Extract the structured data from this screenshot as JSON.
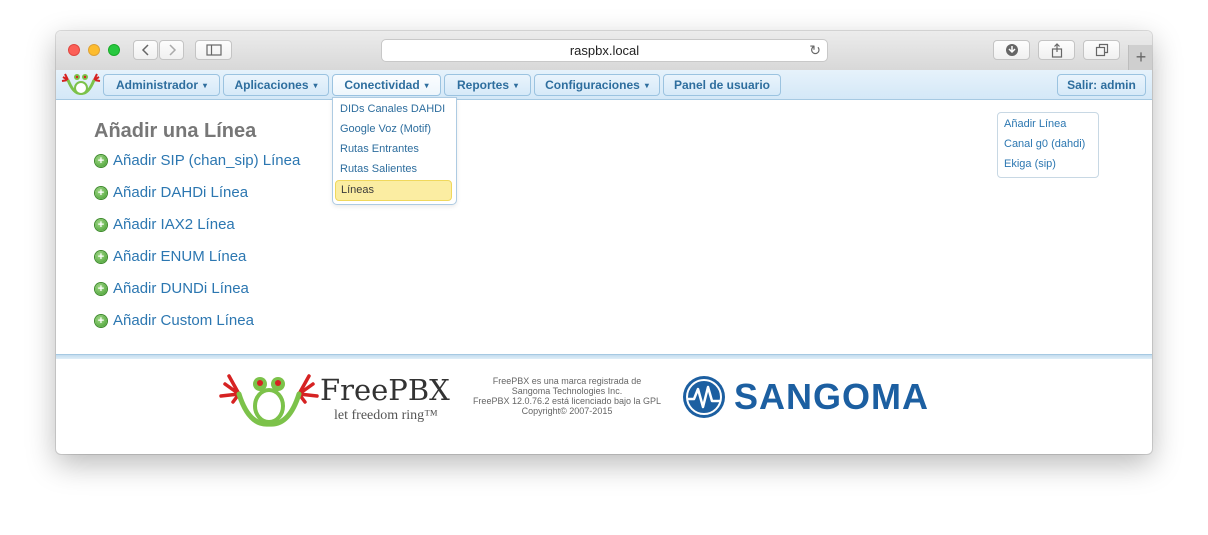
{
  "browser": {
    "url": "raspbx.local"
  },
  "menu": {
    "items": [
      {
        "label": "Administrador",
        "has_caret": true
      },
      {
        "label": "Aplicaciones",
        "has_caret": true
      },
      {
        "label": "Conectividad",
        "has_caret": true
      },
      {
        "label": "Reportes",
        "has_caret": true
      },
      {
        "label": "Configuraciones",
        "has_caret": true
      },
      {
        "label": "Panel de usuario",
        "has_caret": false
      }
    ],
    "logout": "Salir: admin",
    "caret": "▾"
  },
  "dropdown": {
    "items": [
      {
        "label": "DIDs Canales DAHDI"
      },
      {
        "label": "Google Voz (Motif)"
      },
      {
        "label": "Rutas Entrantes"
      },
      {
        "label": "Rutas Salientes"
      },
      {
        "label": "Líneas",
        "active": true
      }
    ]
  },
  "main": {
    "title": "Añadir una Línea",
    "add_links": [
      "Añadir SIP (chan_sip) Línea",
      "Añadir DAHDi Línea",
      "Añadir IAX2 Línea",
      "Añadir ENUM Línea",
      "Añadir DUNDi Línea",
      "Añadir Custom Línea"
    ]
  },
  "sidebar": {
    "links": [
      "Añadir Línea",
      "Canal g0 (dahdi)",
      "Ekiga (sip)"
    ]
  },
  "footer": {
    "freepbx_name": "FreePBX",
    "freepbx_tagline": "let freedom ring™",
    "lines": [
      "FreePBX es una marca registrada de",
      "Sangoma Technologies Inc.",
      "FreePBX 12.0.76.2 está licenciado bajo la GPL",
      "Copyright© 2007-2015"
    ],
    "sangoma_name": "SANGOMA"
  },
  "colors": {
    "accent": "#2e6e9e",
    "link": "#2c77b1",
    "active_item": "#fbeda2",
    "sangoma_blue": "#1c5fa1",
    "frog_green": "#7cc24a",
    "frog_red": "#d62222"
  }
}
